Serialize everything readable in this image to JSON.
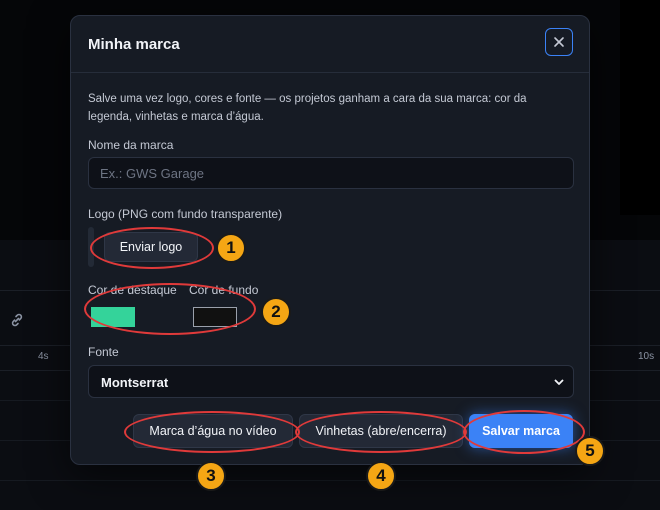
{
  "timeline": {
    "tick_4s": "4s",
    "tick_10s": "10s"
  },
  "modal": {
    "title": "Minha marca",
    "description": "Salve uma vez logo, cores e fonte — os projetos ganham a cara da sua marca: cor da legenda, vinhetas e marca d’água.",
    "brand_name": {
      "label": "Nome da marca",
      "placeholder": "Ex.: GWS Garage",
      "value": ""
    },
    "logo": {
      "label": "Logo (PNG com fundo transparente)",
      "upload_label": "Enviar logo"
    },
    "colors": {
      "accent_label": "Cor de destaque",
      "accent_value": "#34d39a",
      "background_label": "Cor de fundo",
      "background_value": "#111111"
    },
    "font": {
      "label": "Fonte",
      "selected": "Montserrat"
    },
    "actions": {
      "watermark_label": "Marca d’água no vídeo",
      "vignettes_label": "Vinhetas (abre/encerra)",
      "save_label": "Salvar marca"
    }
  },
  "annotations": [
    "1",
    "2",
    "3",
    "4",
    "5"
  ],
  "colors": {
    "accent": "#3b82f6",
    "annotation_ring": "#e03a3a",
    "annotation_badge": "#f5a614"
  }
}
